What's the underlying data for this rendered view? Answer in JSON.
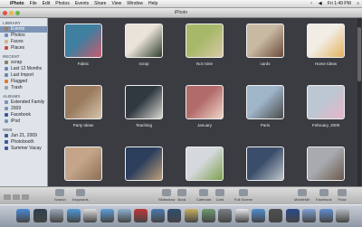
{
  "menubar": {
    "apple": "",
    "items": [
      "iPhoto",
      "File",
      "Edit",
      "Photos",
      "Events",
      "Share",
      "View",
      "Window",
      "Help"
    ],
    "clock": "Fri 1:49 PM"
  },
  "window": {
    "title": "iPhoto"
  },
  "sidebar": {
    "sections": [
      {
        "title": "LIBRARY",
        "items": [
          {
            "label": "Events",
            "color": "#a87a4a",
            "selected": true
          },
          {
            "label": "Photos",
            "color": "#6a8fbf"
          },
          {
            "label": "Faces",
            "color": "#d6b48b"
          },
          {
            "label": "Places",
            "color": "#c94b3d"
          }
        ]
      },
      {
        "title": "RECENT",
        "items": [
          {
            "label": "scrap",
            "color": "#8a7f6d"
          },
          {
            "label": "Last 12 Months",
            "color": "#6d87b5"
          },
          {
            "label": "Last Import",
            "color": "#6d87b5"
          },
          {
            "label": "Flagged",
            "color": "#e37b2d"
          },
          {
            "label": "Trash",
            "color": "#9aa0a8"
          }
        ]
      },
      {
        "title": "ALBUMS",
        "items": [
          {
            "label": "Extended Family",
            "color": "#7c93bd"
          },
          {
            "label": "2009",
            "color": "#7c93bd"
          },
          {
            "label": "Facebook",
            "color": "#3b5998"
          },
          {
            "label": "iPod",
            "color": "#7c93bd"
          }
        ]
      },
      {
        "title": "WEB",
        "items": [
          {
            "label": "Jun 21, 2009",
            "color": "#3b5998"
          },
          {
            "label": "Photobooth",
            "color": "#3b5998"
          },
          {
            "label": "Summer Vacay",
            "color": "#3b5998"
          }
        ]
      }
    ]
  },
  "events": [
    {
      "label": "Fabric",
      "c1": "#3f7fa0",
      "c2": "#c85a6d"
    },
    {
      "label": "scrap",
      "c1": "#e9e3da",
      "c2": "#2f3f2a"
    },
    {
      "label": "Not mine",
      "c1": "#a8b86a",
      "c2": "#d8c9a6"
    },
    {
      "label": "cards",
      "c1": "#c8b9a2",
      "c2": "#6b4a3a"
    },
    {
      "label": "Home Ideas",
      "c1": "#f1ede5",
      "c2": "#e4b15a"
    },
    {
      "label": "Party Ideas",
      "c1": "#9a7b5e",
      "c2": "#d6c5ad"
    },
    {
      "label": "Teaching",
      "c1": "#303840",
      "c2": "#d8d8d0"
    },
    {
      "label": "January",
      "c1": "#b26b6b",
      "c2": "#f0d6c8"
    },
    {
      "label": "Paris",
      "c1": "#9fb5c8",
      "c2": "#4a4a4a"
    },
    {
      "label": "February, 2009",
      "c1": "#bcc7d3",
      "c2": "#e6b5c8"
    },
    {
      "label": "",
      "c1": "#c4a58a",
      "c2": "#8a6e55"
    },
    {
      "label": "",
      "c1": "#2b3e5c",
      "c2": "#bfa07a"
    },
    {
      "label": "",
      "c1": "#d5d9dd",
      "c2": "#7da04e"
    },
    {
      "label": "",
      "c1": "#3a4d6a",
      "c2": "#c0c6cc"
    },
    {
      "label": "",
      "c1": "#a8aab0",
      "c2": "#6b5a4a"
    }
  ],
  "toolbar": {
    "left": [
      {
        "label": "Search"
      },
      {
        "label": "Keywords"
      }
    ],
    "center": [
      {
        "label": "Slideshow"
      },
      {
        "label": "Book"
      },
      {
        "label": "Calendar"
      },
      {
        "label": "Card"
      },
      {
        "label": "Full Screen"
      }
    ],
    "right": [
      {
        "label": "MobileMe"
      },
      {
        "label": "Facebook"
      },
      {
        "label": "Flickr"
      }
    ]
  },
  "dock": {
    "icons": [
      {
        "name": "finder-icon",
        "color": "#4a8ad8"
      },
      {
        "name": "dashboard-icon",
        "color": "#2f3f4f"
      },
      {
        "name": "mail-icon",
        "color": "#9aa8b8"
      },
      {
        "name": "safari-icon",
        "color": "#4e9ad8"
      },
      {
        "name": "ical-icon",
        "color": "#e0e0e0"
      },
      {
        "name": "itunes-icon",
        "color": "#5f9fd8"
      },
      {
        "name": "iphoto-icon",
        "color": "#8fb0d0"
      },
      {
        "name": "photobooth-icon",
        "color": "#c03838"
      },
      {
        "name": "iweb-icon",
        "color": "#4a7ab0"
      },
      {
        "name": "imovie-icon",
        "color": "#2f4f6f"
      },
      {
        "name": "garageband-icon",
        "color": "#c8b060"
      },
      {
        "name": "preview-icon",
        "color": "#6f9a6f"
      },
      {
        "name": "system-prefs-icon",
        "color": "#7a7f86"
      },
      {
        "name": "textedit-icon",
        "color": "#e8e8e8"
      },
      {
        "name": "ichat-icon",
        "color": "#4f8fd0"
      },
      {
        "name": "calculator-icon",
        "color": "#4f4f4f"
      },
      {
        "name": "photoshop-icon",
        "color": "#2b4a8a"
      },
      {
        "name": "folder-icon",
        "color": "#7ea0d6"
      },
      {
        "name": "downloads-icon",
        "color": "#5f8fd0"
      },
      {
        "name": "trash-icon",
        "color": "#b5b9be"
      }
    ]
  }
}
